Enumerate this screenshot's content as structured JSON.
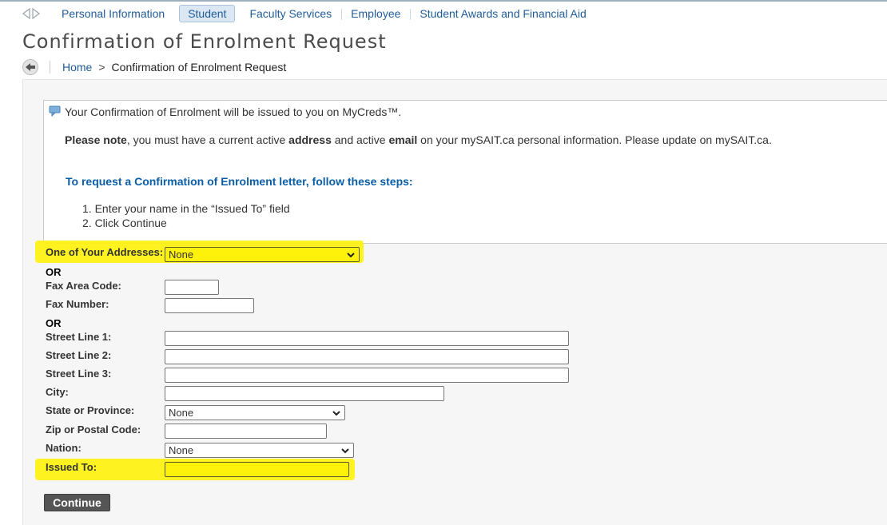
{
  "nav": {
    "tabs": [
      {
        "label": "Personal Information"
      },
      {
        "label": "Student"
      },
      {
        "label": "Faculty Services"
      },
      {
        "label": "Employee"
      },
      {
        "label": "Student Awards and Financial Aid"
      }
    ],
    "active_tab": "Student"
  },
  "page": {
    "title": "Confirmation of Enrolment Request"
  },
  "breadcrumb": {
    "home": "Home",
    "separator": ">",
    "current": "Confirmation of Enrolment Request"
  },
  "info": {
    "line1": "Your Confirmation of Enrolment will be issued to you on MyCreds™.",
    "note_parts": [
      {
        "text": "Please note",
        "bold": true
      },
      {
        "text": ", you must have a current active ",
        "bold": false
      },
      {
        "text": "address",
        "bold": true
      },
      {
        "text": " and active ",
        "bold": false
      },
      {
        "text": "email",
        "bold": true
      },
      {
        "text": " on your mySAIT.ca personal information. Please update on mySAIT.ca.",
        "bold": false
      }
    ],
    "heading": "To request a Confirmation of Enrolment letter, follow these steps:",
    "steps": [
      "1. Enter your name in the “Issued To” field",
      "2. Click Continue"
    ]
  },
  "form": {
    "address_label": "One of Your Addresses:",
    "address_value": "None",
    "or1": "OR",
    "fax_area_label": "Fax Area Code:",
    "fax_area_value": "",
    "fax_number_label": "Fax Number:",
    "fax_number_value": "",
    "or2": "OR",
    "street1_label": "Street Line 1:",
    "street1_value": "",
    "street2_label": "Street Line 2:",
    "street2_value": "",
    "street3_label": "Street Line 3:",
    "street3_value": "",
    "city_label": "City:",
    "city_value": "",
    "state_label": "State or Province:",
    "state_value": "None",
    "zip_label": "Zip or Postal Code:",
    "zip_value": "",
    "nation_label": "Nation:",
    "nation_value": "None",
    "issued_to_label": "Issued To:",
    "issued_to_value": "",
    "continue_label": "Continue"
  },
  "colors": {
    "link": "#1f5c99",
    "heading_blue": "#0a5ea8",
    "highlight": "#fff20a",
    "button": "#555555"
  },
  "icons": [
    "nav-left-arrow-icon",
    "nav-right-arrow-icon",
    "back-arrow-icon",
    "info-message-icon",
    "chevron-down-icon"
  ]
}
